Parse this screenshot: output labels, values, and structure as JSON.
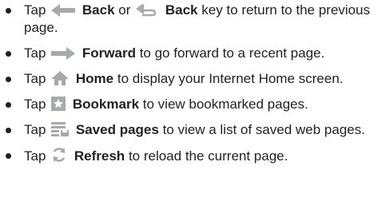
{
  "items": [
    {
      "pre": "Tap",
      "icon": "back-arrow-icon",
      "bold": "Back",
      "mid": "or",
      "icon2": "back-key-icon",
      "bold2": "Back",
      "post": "key to return to the previous page."
    },
    {
      "pre": "Tap",
      "icon": "forward-arrow-icon",
      "bold": "Forward",
      "post": "to go forward to a recent page."
    },
    {
      "pre": "Tap",
      "icon": "home-icon",
      "bold": "Home",
      "post": "to display your Internet Home screen."
    },
    {
      "pre": "Tap",
      "icon": "bookmark-icon",
      "bold": "Bookmark",
      "post": "to view bookmarked pages."
    },
    {
      "pre": "Tap",
      "icon": "saved-pages-icon",
      "bold": "Saved pages",
      "post": "to view a list of saved web pages."
    },
    {
      "pre": "Tap",
      "icon": "refresh-icon",
      "bold": "Refresh",
      "post": "to reload the current page."
    }
  ],
  "colors": {
    "icon_gray": "#a7a9ac",
    "text": "#231f20"
  }
}
